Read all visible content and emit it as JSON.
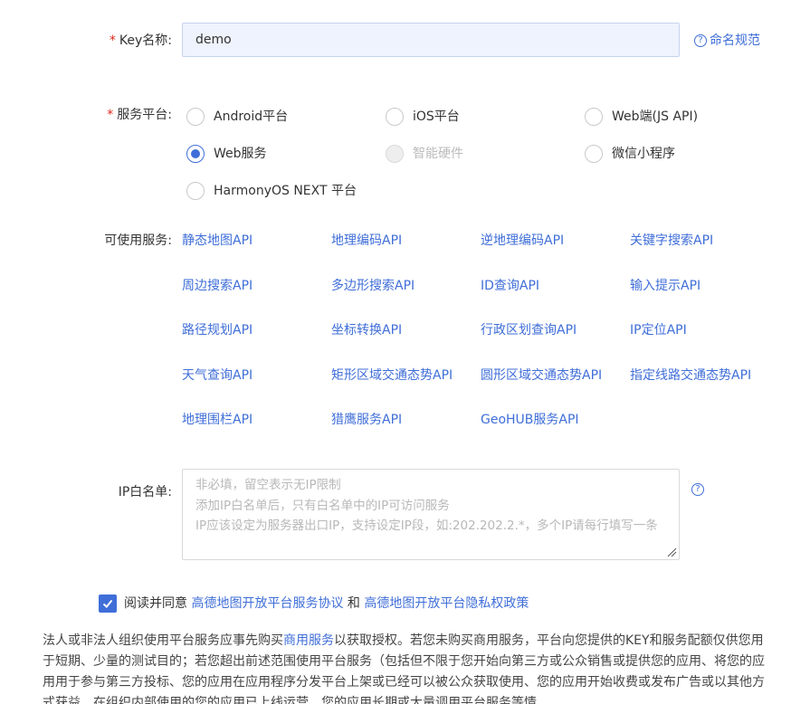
{
  "key_name": {
    "required_mark": "*",
    "label": "Key名称:",
    "value": "demo",
    "help_label": "命名规范"
  },
  "platform": {
    "required_mark": "*",
    "label": "服务平台:",
    "options": [
      {
        "label": "Android平台",
        "state": "unchecked"
      },
      {
        "label": "iOS平台",
        "state": "unchecked"
      },
      {
        "label": "Web端(JS API)",
        "state": "unchecked"
      },
      {
        "label": "Web服务",
        "state": "checked"
      },
      {
        "label": "智能硬件",
        "state": "disabled"
      },
      {
        "label": "微信小程序",
        "state": "unchecked"
      },
      {
        "label": "HarmonyOS NEXT 平台",
        "state": "unchecked"
      }
    ]
  },
  "services": {
    "label": "可使用服务:",
    "items": [
      "静态地图API",
      "地理编码API",
      "逆地理编码API",
      "关键字搜索API",
      "周边搜索API",
      "多边形搜索API",
      "ID查询API",
      "输入提示API",
      "路径规划API",
      "坐标转换API",
      "行政区划查询API",
      "IP定位API",
      "天气查询API",
      "矩形区域交通态势API",
      "圆形区域交通态势API",
      "指定线路交通态势API",
      "地理围栏API",
      "猎鹰服务API",
      "GeoHUB服务API"
    ]
  },
  "ip_whitelist": {
    "label": "IP白名单:",
    "placeholder": "非必填，留空表示无IP限制\n添加IP白名单后，只有白名单中的IP可访问服务\nIP应该设定为服务器出口IP，支持设定IP段，如:202.202.2.*，多个IP请每行填写一条"
  },
  "agreement": {
    "checked": true,
    "prefix": "阅读并同意",
    "link1": "高德地图开放平台服务协议",
    "conjunction": "和",
    "link2": "高德地图开放平台隐私权政策"
  },
  "notice": {
    "part1": "法人或非法人组织使用平台服务应事先购买",
    "link": "商用服务",
    "part2": "以获取授权。若您未购买商用服务，平台向您提供的KEY和服务配额仅供您用于短期、少量的测试目的；若您超出前述范围使用平台服务（包括但不限于您开始向第三方或公众销售或提供您的应用、将您的应用用于参与第三方投标、您的应用在应用程序分发平台上架或已经可以被公众获取使用、您的应用开始收费或发布广告或以其他方式获益、在组织内部使用的您的应用已上线运营、您的应用长期或大量调用平台服务等情"
  },
  "colors": {
    "accent": "#3f6ed8",
    "required": "#e1251b",
    "input_bg": "#eef3fd"
  }
}
